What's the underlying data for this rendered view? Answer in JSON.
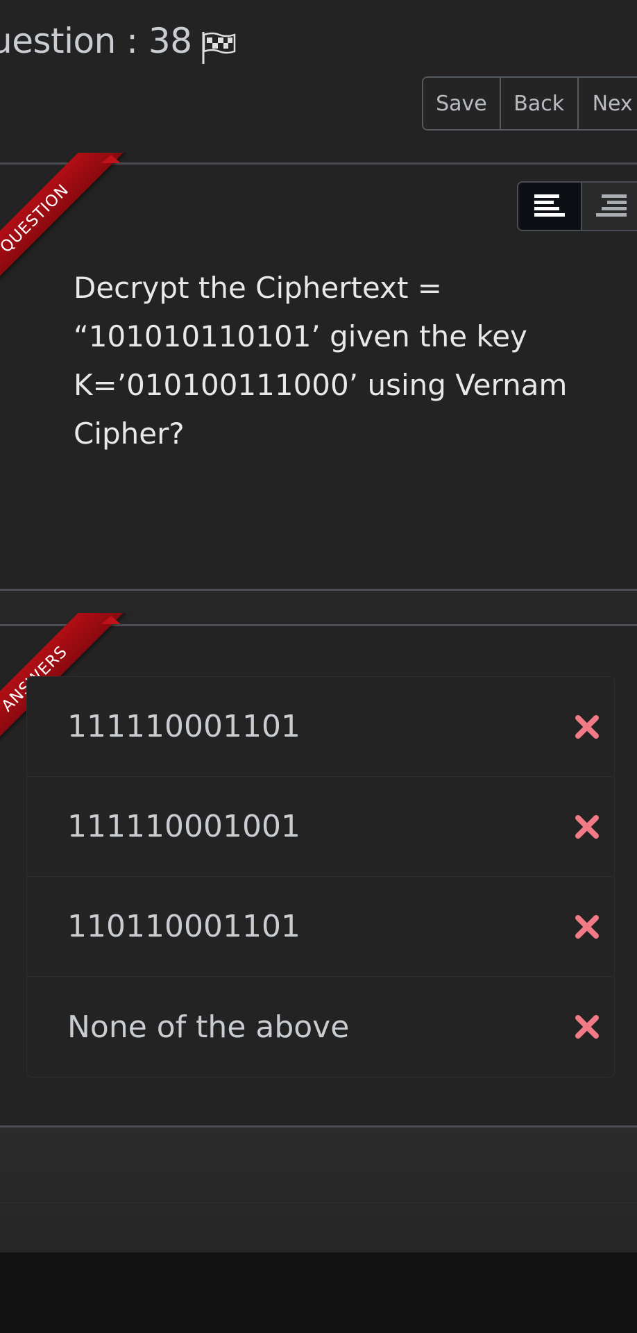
{
  "header": {
    "question_label": "uestion : 38",
    "flag_icon": "flag-icon"
  },
  "toolbar": {
    "save_label": "Save",
    "back_label": "Back",
    "next_label": "Nex"
  },
  "alignment": {
    "left_icon": "align-left-icon",
    "right_icon": "align-right-icon"
  },
  "question": {
    "ribbon_label": "QUESTION",
    "text": "Decrypt the Ciphertext = “101010110101’ given the key K=’010100111000’ using Vernam Cipher?"
  },
  "answers": {
    "ribbon_label": "ANSWERS",
    "items": [
      {
        "label": "111110001101",
        "status_icon": "wrong-x-icon"
      },
      {
        "label": "111110001001",
        "status_icon": "wrong-x-icon"
      },
      {
        "label": "110110001101",
        "status_icon": "wrong-x-icon"
      },
      {
        "label": "None of the above",
        "status_icon": "wrong-x-icon"
      }
    ]
  },
  "colors": {
    "background": "#232323",
    "ribbon": "#b10e15",
    "wrong_icon": "#f07a86",
    "text": "#e6e8ea"
  }
}
